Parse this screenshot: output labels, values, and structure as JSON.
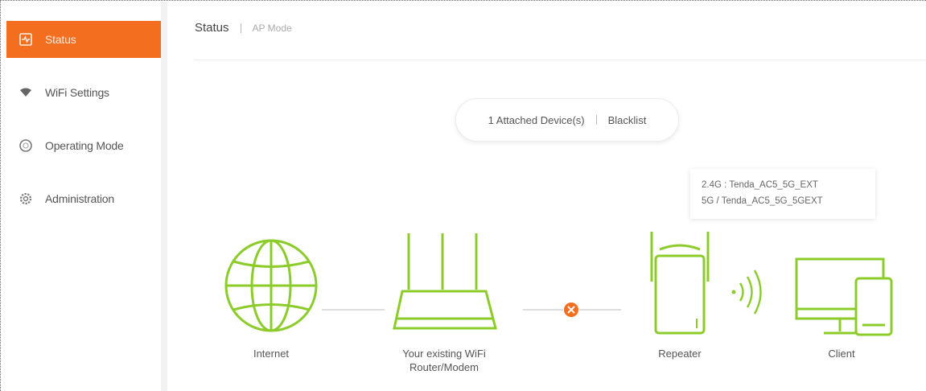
{
  "sidebar": {
    "items": [
      {
        "label": "Status",
        "icon": "status-icon",
        "active": true
      },
      {
        "label": "WiFi Settings",
        "icon": "wifi-icon",
        "active": false
      },
      {
        "label": "Operating Mode",
        "icon": "operating-mode-icon",
        "active": false
      },
      {
        "label": "Administration",
        "icon": "gear-icon",
        "active": false
      }
    ]
  },
  "header": {
    "title": "Status",
    "subtitle": "AP Mode"
  },
  "devices": {
    "attached_label": "1 Attached Device(s)",
    "blacklist_label": "Blacklist"
  },
  "ssid": {
    "band_24": "2.4G",
    "name_24": "Tenda_AC5_5G_EXT",
    "band_5": "5G",
    "name_5": "Tenda_AC5_5G_5GEXT"
  },
  "topology": {
    "internet_label": "Internet",
    "router_label_line1": "Your existing WiFi",
    "router_label_line2": "Router/Modem",
    "repeater_label": "Repeater",
    "client_label": "Client",
    "connection_status": "disconnected"
  },
  "colors": {
    "accent": "#f36e1e",
    "device_green": "#8ccc2a",
    "error_orange": "#f36e1e"
  }
}
